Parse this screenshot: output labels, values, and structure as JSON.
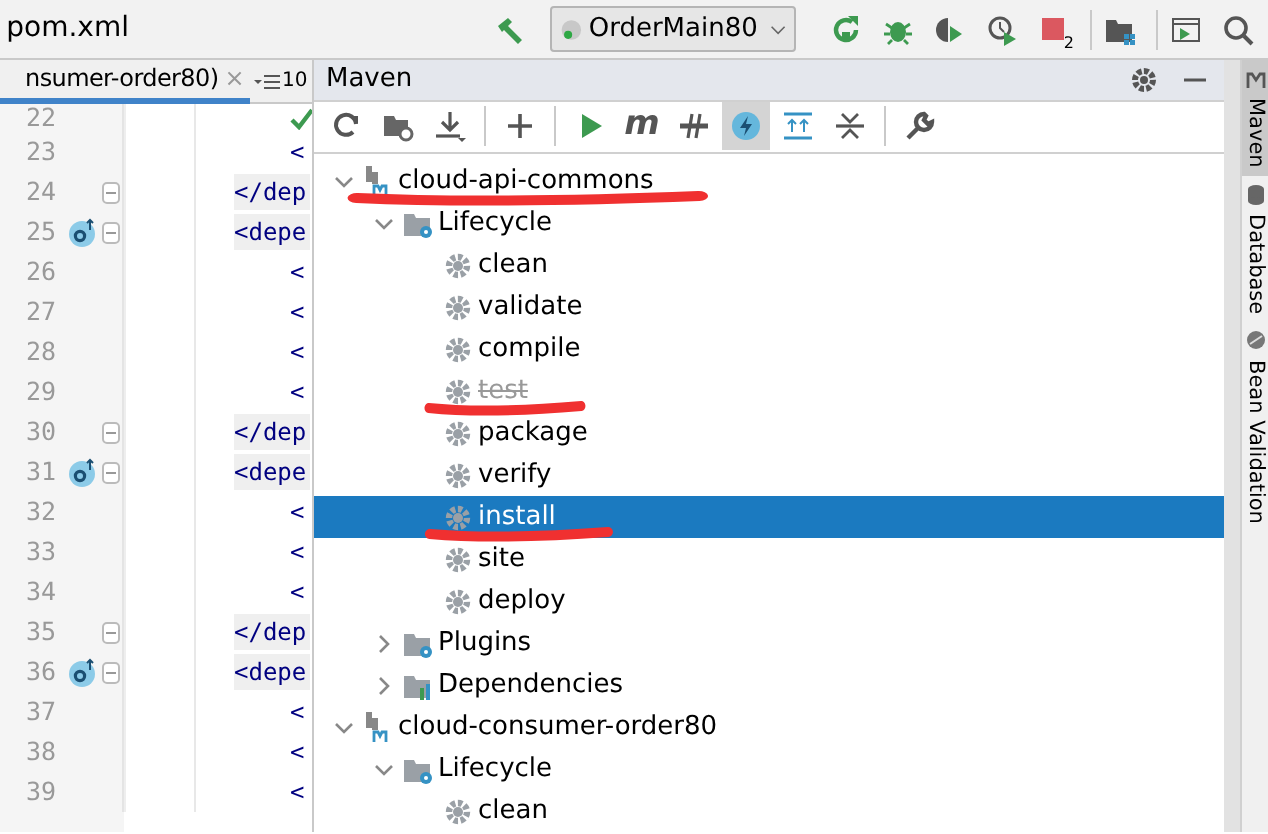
{
  "toolbar": {
    "file": "pom.xml",
    "run_config": "OrderMain80",
    "stop_badge": "2",
    "icons": [
      {
        "kind": "build"
      },
      {
        "kind": "rerun"
      },
      {
        "kind": "debug"
      },
      {
        "kind": "coverage"
      },
      {
        "kind": "profile"
      },
      {
        "kind": "stop"
      },
      {
        "kind": "structure"
      },
      {
        "kind": "terminal"
      },
      {
        "kind": "search"
      }
    ]
  },
  "editor": {
    "tab": {
      "label": "nsumer-order80)",
      "close": "×"
    },
    "tab_count": "10",
    "lines": [
      {
        "number": "22",
        "kind": "check"
      },
      {
        "number": "23",
        "kind": "inner",
        "code": "<"
      },
      {
        "number": "24",
        "kind": "block",
        "code": "</dep",
        "fold": true
      },
      {
        "number": "25",
        "kind": "block",
        "code": "<depe",
        "fold": true,
        "override": true
      },
      {
        "number": "26",
        "kind": "inner",
        "code": "<"
      },
      {
        "number": "27",
        "kind": "inner",
        "code": "<"
      },
      {
        "number": "28",
        "kind": "inner",
        "code": "<"
      },
      {
        "number": "29",
        "kind": "inner",
        "code": "<"
      },
      {
        "number": "30",
        "kind": "block",
        "code": "</dep",
        "fold": true
      },
      {
        "number": "31",
        "kind": "block",
        "code": "<depe",
        "fold": true,
        "override": true
      },
      {
        "number": "32",
        "kind": "inner",
        "code": "<"
      },
      {
        "number": "33",
        "kind": "inner",
        "code": "<"
      },
      {
        "number": "34",
        "kind": "inner",
        "code": "<"
      },
      {
        "number": "35",
        "kind": "block",
        "code": "</dep",
        "fold": true
      },
      {
        "number": "36",
        "kind": "block",
        "code": "<depe",
        "fold": true,
        "override": true
      },
      {
        "number": "37",
        "kind": "inner",
        "code": "<"
      },
      {
        "number": "38",
        "kind": "inner",
        "code": "<"
      },
      {
        "number": "39",
        "kind": "inner",
        "code": "<"
      }
    ]
  },
  "maven": {
    "title": "Maven",
    "tools": [
      {
        "kind": "reload",
        "selected": false
      },
      {
        "kind": "folder",
        "selected": false
      },
      {
        "kind": "download",
        "selected": false
      },
      {
        "kind": "sep"
      },
      {
        "kind": "add",
        "selected": false
      },
      {
        "kind": "sep"
      },
      {
        "kind": "run",
        "selected": false
      },
      {
        "kind": "m",
        "label": "m",
        "selected": false
      },
      {
        "kind": "skip",
        "selected": false
      },
      {
        "kind": "offline",
        "selected": true
      },
      {
        "kind": "expand",
        "selected": false
      },
      {
        "kind": "collapse",
        "selected": false
      },
      {
        "kind": "sep"
      },
      {
        "kind": "wrench",
        "selected": false
      }
    ],
    "tree": [
      {
        "label": "cloud-api-commons",
        "kind": "project",
        "expanded": true,
        "selected": false,
        "underlined": true,
        "children": [
          {
            "label": "Lifecycle",
            "kind": "folder",
            "expanded": true,
            "selected": false,
            "children": [
              {
                "label": "clean",
                "kind": "goal",
                "selected": false,
                "disabled": false
              },
              {
                "label": "validate",
                "kind": "goal",
                "selected": false,
                "disabled": false
              },
              {
                "label": "compile",
                "kind": "goal",
                "selected": false,
                "disabled": false
              },
              {
                "label": "test",
                "kind": "goal",
                "selected": false,
                "disabled": true,
                "underlined": true
              },
              {
                "label": "package",
                "kind": "goal",
                "selected": false,
                "disabled": false
              },
              {
                "label": "verify",
                "kind": "goal",
                "selected": false,
                "disabled": false
              },
              {
                "label": "install",
                "kind": "goal",
                "selected": true,
                "disabled": false,
                "underlined": true
              },
              {
                "label": "site",
                "kind": "goal",
                "selected": false,
                "disabled": false
              },
              {
                "label": "deploy",
                "kind": "goal",
                "selected": false,
                "disabled": false
              }
            ]
          },
          {
            "label": "Plugins",
            "kind": "folder",
            "expanded": false,
            "selected": false
          },
          {
            "label": "Dependencies",
            "kind": "deps",
            "expanded": false,
            "selected": false
          }
        ]
      },
      {
        "label": "cloud-consumer-order80",
        "kind": "project",
        "expanded": true,
        "selected": false,
        "children": [
          {
            "label": "Lifecycle",
            "kind": "folder",
            "expanded": true,
            "selected": false,
            "children": [
              {
                "label": "clean",
                "kind": "goal",
                "selected": false,
                "disabled": false
              }
            ]
          }
        ]
      }
    ]
  },
  "side_tabs": [
    {
      "label": "Maven",
      "kind": "maven",
      "selected": true
    },
    {
      "label": "Database",
      "kind": "database",
      "selected": false
    },
    {
      "label": "Bean Validation",
      "kind": "bean",
      "selected": false
    }
  ]
}
